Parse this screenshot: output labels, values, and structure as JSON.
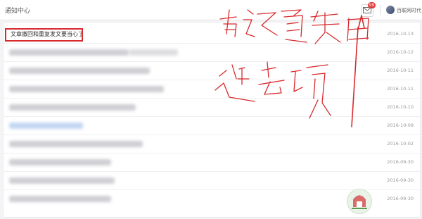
{
  "header": {
    "title": "通知中心",
    "mail_badge": "99",
    "user_name": "百联网时代"
  },
  "notifications": [
    {
      "text": "文章撤回和重复发文要当心了",
      "date": "2016-10-13"
    },
    {
      "text": "",
      "date": "2016-10-12"
    },
    {
      "text": "",
      "date": "2016-10-11"
    },
    {
      "text": "",
      "date": "2016-10-11"
    },
    {
      "text": "",
      "date": "2016-10-10"
    },
    {
      "text": "",
      "date": "2016-10-09"
    },
    {
      "text": "",
      "date": "2016-10-02"
    },
    {
      "text": "",
      "date": "2016-09-30"
    },
    {
      "text": "",
      "date": "2016-09-30"
    },
    {
      "text": "",
      "date": "2016-09-30"
    }
  ],
  "colors": {
    "annotation": "#d8292c",
    "badge": "#e23b3b"
  }
}
